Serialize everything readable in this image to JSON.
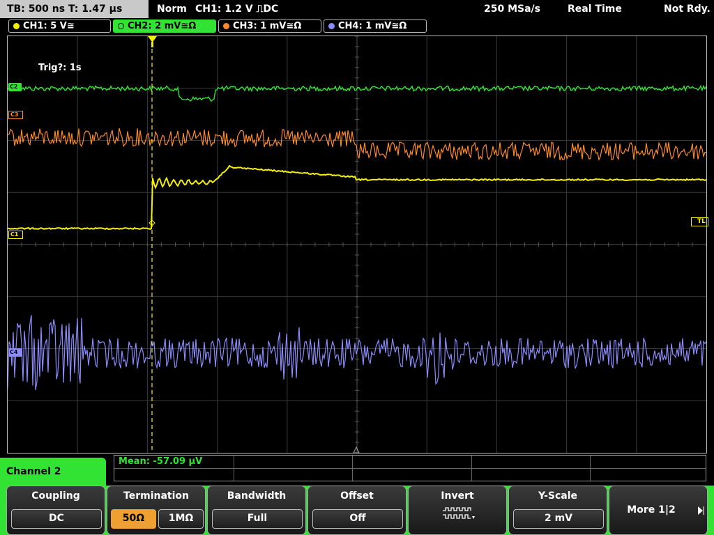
{
  "status": {
    "timebase": "TB: 500 ns   T: 1.47 µs",
    "mode": "Norm",
    "trigger_info": "CH1: 1.2 V ⎍DC",
    "sample_rate": "250 MSa/s",
    "acq_mode": "Real Time",
    "ready_state": "Not Rdy."
  },
  "channels": [
    {
      "label": "CH1: 5 V≅",
      "color": "#f5f000"
    },
    {
      "label": "CH2: 2 mV≅Ω",
      "color": "#33e333"
    },
    {
      "label": "CH3: 1 mV≅Ω",
      "color": "#ff8a2a"
    },
    {
      "label": "CH4: 1 mV≅Ω",
      "color": "#8c8cff"
    }
  ],
  "plot": {
    "trigger_annotation": "Trig?: 1s",
    "marker_c1": "C1",
    "marker_c2": "C2",
    "marker_c3": "C3",
    "marker_c4": "C4",
    "marker_tl": "TL",
    "trigger_marker": "T"
  },
  "panel": {
    "title": "Channel 2",
    "measurement": "Mean: -57.09 µV"
  },
  "softkeys": {
    "coupling": {
      "title": "Coupling",
      "value": "DC"
    },
    "termination": {
      "title": "Termination",
      "opt1": "50Ω",
      "opt2": "1MΩ"
    },
    "bandwidth": {
      "title": "Bandwidth",
      "value": "Full"
    },
    "offset": {
      "title": "Offset",
      "value": "Off"
    },
    "invert": {
      "title": "Invert"
    },
    "yscale": {
      "title": "Y-Scale",
      "value": "2 mV"
    },
    "more": {
      "label": "More 1|2"
    }
  }
}
